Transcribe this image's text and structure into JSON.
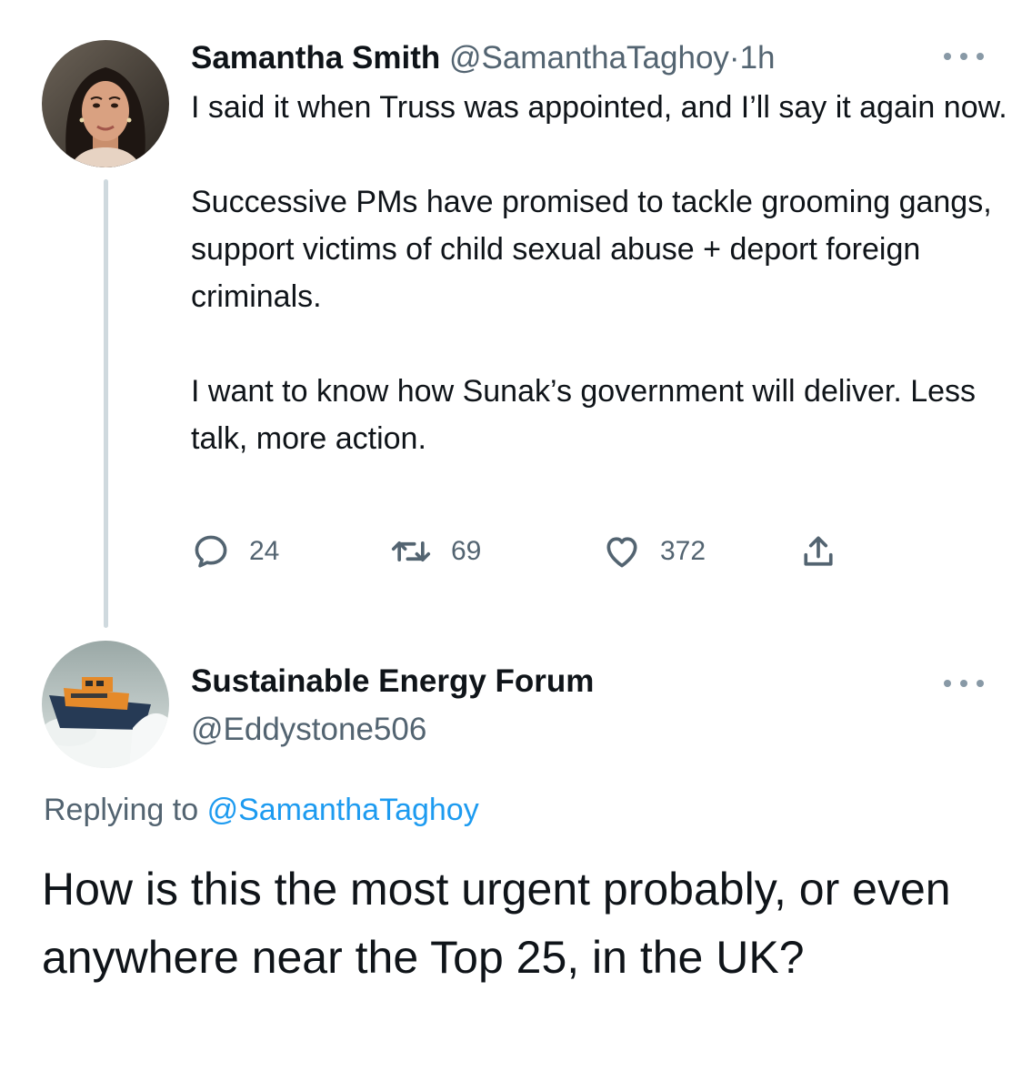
{
  "original_tweet": {
    "display_name": "Samantha Smith",
    "handle": "@SamanthaTaghoy",
    "separator": "·",
    "time": "1h",
    "avatar_icon": "woman-portrait-avatar",
    "text_paragraphs": [
      "I said it when Truss was appointed, and I’ll say it again now.",
      "Successive PMs have promised to tackle grooming gangs, support victims of child sexual abuse + deport foreign criminals.",
      "I want to know how Sunak’s government will deliver. Less talk, more action."
    ],
    "metrics": {
      "replies": "24",
      "retweets": "69",
      "likes": "372"
    }
  },
  "reply_tweet": {
    "display_name": "Sustainable Energy Forum",
    "handle": "@Eddystone506",
    "avatar_icon": "lifeboat-avatar",
    "replying_prefix": "Replying to",
    "replying_to": "@SamanthaTaghoy",
    "text": "How is this the most urgent probably, or even anywhere near the Top 25, in the UK?"
  },
  "colors": {
    "text": "#0f1419",
    "muted": "#536471",
    "link": "#1d9bf0",
    "thread_line": "#cfd9de"
  },
  "icons": {
    "reply": "reply-bubble-icon",
    "retweet": "retweet-icon",
    "like": "heart-icon",
    "share": "share-upload-icon",
    "more": "more-dots-icon"
  }
}
